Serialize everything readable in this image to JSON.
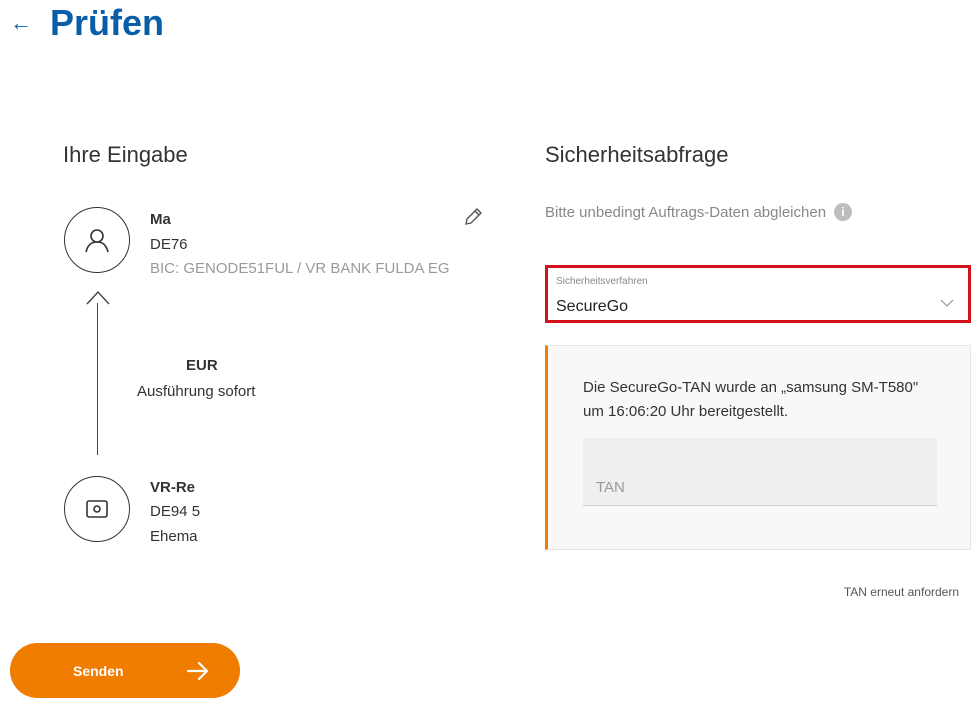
{
  "header": {
    "back_icon": "arrow-left-icon",
    "title": "Prüfen"
  },
  "input_section": {
    "title": "Ihre Eingabe",
    "recipient": {
      "icon": "person-icon",
      "name": "Ma",
      "iban": "DE76",
      "bic": "BIC: GENODE51FUL / VR BANK FULDA EG"
    },
    "amount": {
      "currency": "EUR",
      "execution": "Ausführung sofort"
    },
    "sender": {
      "icon": "account-card-icon",
      "name": "VR-Re",
      "iban": "DE94 5",
      "owner": "Ehema"
    }
  },
  "security": {
    "title": "Sicherheitsabfrage",
    "hint": "Bitte unbedingt Auftrags-Daten abgleichen",
    "select_label": "Sicherheitsverfahren",
    "select_value": "SecureGo",
    "tan_message": "Die SecureGo-TAN wurde an „samsung SM-T580\" um 16:06:20 Uhr bereitgestellt.",
    "tan_placeholder": "TAN",
    "resend_link": "TAN erneut anfordern"
  },
  "actions": {
    "send_label": "Senden"
  },
  "colors": {
    "brand_blue": "#0a5ea8",
    "accent_orange": "#f07c00",
    "highlight_red": "#d4121b"
  }
}
